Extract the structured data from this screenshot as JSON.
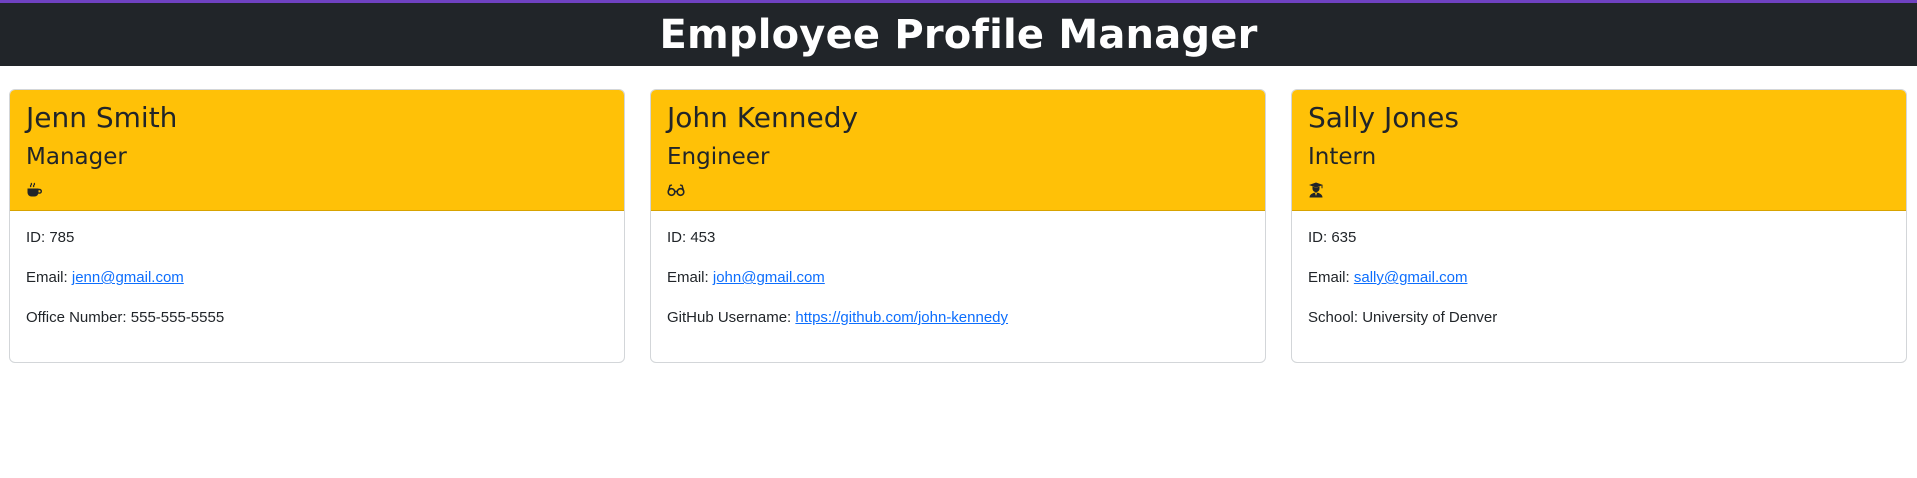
{
  "header": {
    "title": "Employee Profile Manager"
  },
  "colors": {
    "header_bg": "#212529",
    "accent_top": "#6f42c1",
    "card_header_bg": "#ffc107",
    "link": "#0d6efd"
  },
  "employees": [
    {
      "name": "Jenn Smith",
      "role": "Manager",
      "icon": "coffee-icon",
      "id_label": "ID:",
      "id_value": "785",
      "email_label": "Email:",
      "email": "jenn@gmail.com",
      "extra_label": "Office Number:",
      "extra_value": "555-555-5555"
    },
    {
      "name": "John Kennedy",
      "role": "Engineer",
      "icon": "glasses-icon",
      "id_label": "ID:",
      "id_value": "453",
      "email_label": "Email:",
      "email": "john@gmail.com",
      "extra_label": "GitHub Username:",
      "extra_value": "https://github.com/john-kennedy"
    },
    {
      "name": "Sally Jones",
      "role": "Intern",
      "icon": "graduate-icon",
      "id_label": "ID:",
      "id_value": "635",
      "email_label": "Email:",
      "email": "sally@gmail.com",
      "extra_label": "School:",
      "extra_value": "University of Denver"
    }
  ]
}
